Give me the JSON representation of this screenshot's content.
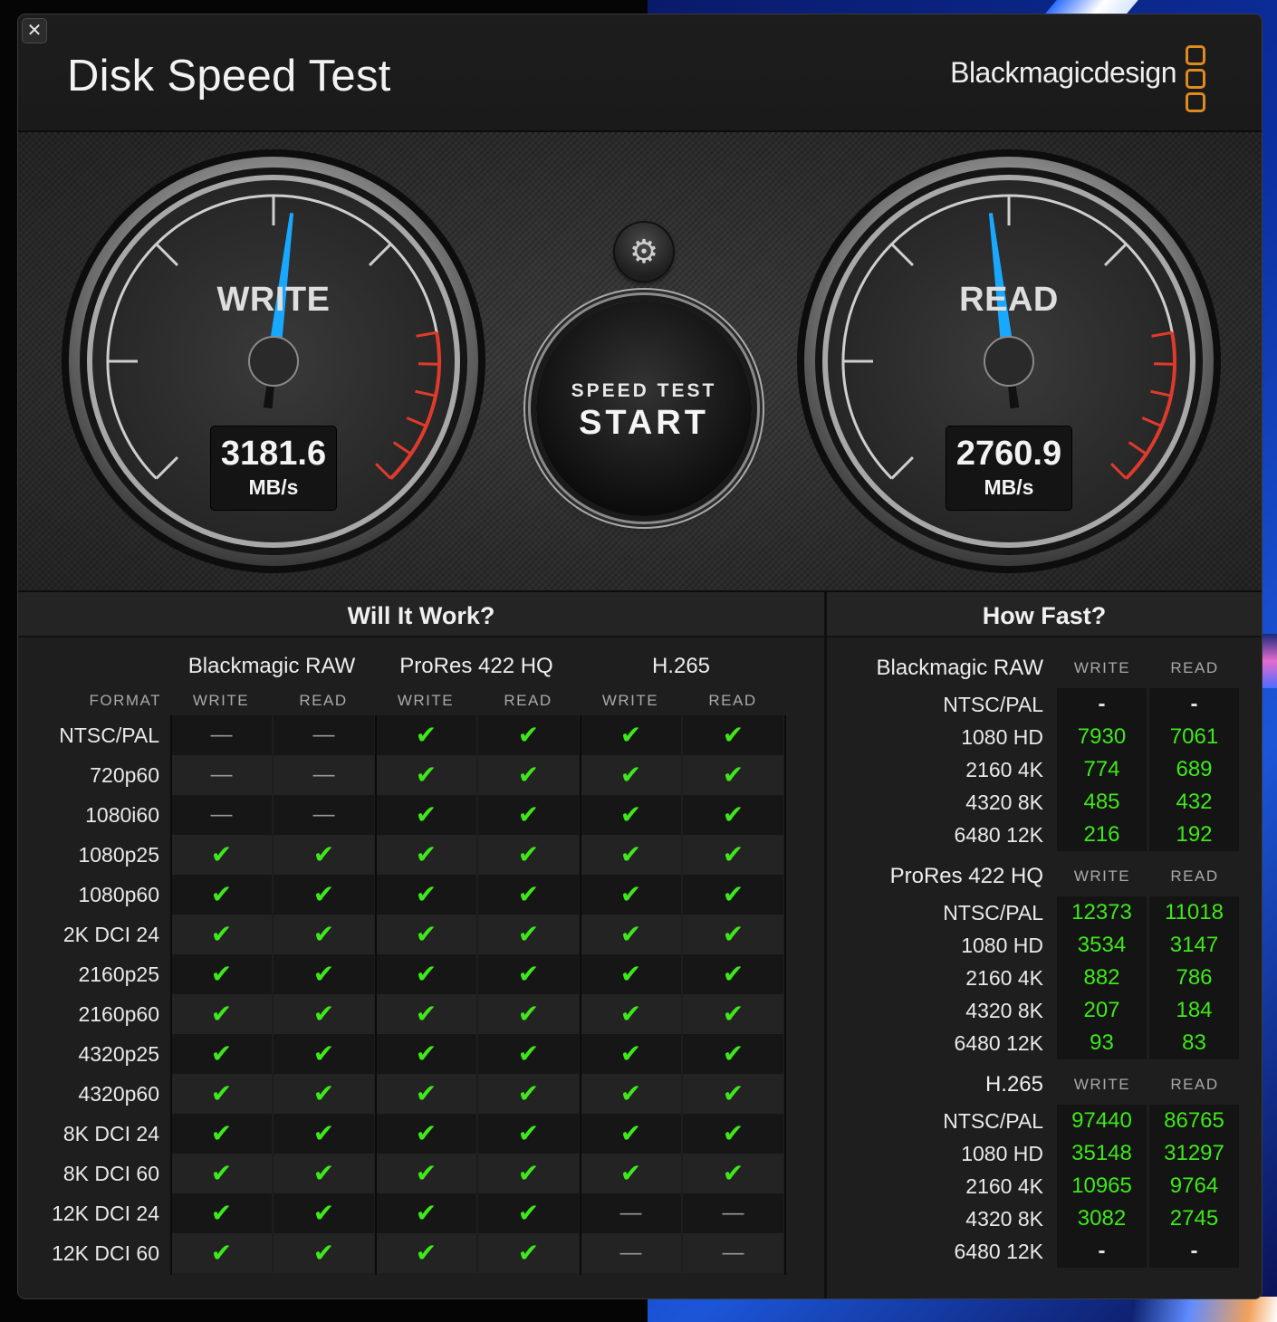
{
  "window": {
    "title": "Disk Speed Test",
    "brand": "Blackmagicdesign",
    "close_glyph": "✕",
    "accent_color": "#e08a1e",
    "check_color": "#3ee81a"
  },
  "gauges": {
    "write": {
      "label": "WRITE",
      "value": "3181.6",
      "unit": "MB/s",
      "needle_color": "#18a8ff"
    },
    "read": {
      "label": "READ",
      "value": "2760.9",
      "unit": "MB/s",
      "needle_color": "#18a8ff"
    }
  },
  "controls": {
    "settings_icon": "gear-icon",
    "settings_glyph": "⚙",
    "start_line1": "SPEED TEST",
    "start_line2": "START"
  },
  "will_it_work": {
    "title": "Will It Work?",
    "format_label": "FORMAT",
    "groups": [
      "Blackmagic RAW",
      "ProRes 422 HQ",
      "H.265"
    ],
    "sub_cols": [
      "WRITE",
      "READ"
    ],
    "rows": [
      {
        "format": "NTSC/PAL",
        "cells": [
          "-",
          "-",
          "ok",
          "ok",
          "ok",
          "ok"
        ]
      },
      {
        "format": "720p60",
        "cells": [
          "-",
          "-",
          "ok",
          "ok",
          "ok",
          "ok"
        ]
      },
      {
        "format": "1080i60",
        "cells": [
          "-",
          "-",
          "ok",
          "ok",
          "ok",
          "ok"
        ]
      },
      {
        "format": "1080p25",
        "cells": [
          "ok",
          "ok",
          "ok",
          "ok",
          "ok",
          "ok"
        ]
      },
      {
        "format": "1080p60",
        "cells": [
          "ok",
          "ok",
          "ok",
          "ok",
          "ok",
          "ok"
        ]
      },
      {
        "format": "2K DCI 24",
        "cells": [
          "ok",
          "ok",
          "ok",
          "ok",
          "ok",
          "ok"
        ]
      },
      {
        "format": "2160p25",
        "cells": [
          "ok",
          "ok",
          "ok",
          "ok",
          "ok",
          "ok"
        ]
      },
      {
        "format": "2160p60",
        "cells": [
          "ok",
          "ok",
          "ok",
          "ok",
          "ok",
          "ok"
        ]
      },
      {
        "format": "4320p25",
        "cells": [
          "ok",
          "ok",
          "ok",
          "ok",
          "ok",
          "ok"
        ]
      },
      {
        "format": "4320p60",
        "cells": [
          "ok",
          "ok",
          "ok",
          "ok",
          "ok",
          "ok"
        ]
      },
      {
        "format": "8K DCI 24",
        "cells": [
          "ok",
          "ok",
          "ok",
          "ok",
          "ok",
          "ok"
        ]
      },
      {
        "format": "8K DCI 60",
        "cells": [
          "ok",
          "ok",
          "ok",
          "ok",
          "ok",
          "ok"
        ]
      },
      {
        "format": "12K DCI 24",
        "cells": [
          "ok",
          "ok",
          "ok",
          "ok",
          "-",
          "-"
        ]
      },
      {
        "format": "12K DCI 60",
        "cells": [
          "ok",
          "ok",
          "ok",
          "ok",
          "-",
          "-"
        ]
      }
    ]
  },
  "how_fast": {
    "title": "How Fast?",
    "write_label": "WRITE",
    "read_label": "READ",
    "sections": [
      {
        "codec": "Blackmagic RAW",
        "rows": [
          {
            "format": "NTSC/PAL",
            "write": "-",
            "read": "-"
          },
          {
            "format": "1080 HD",
            "write": "7930",
            "read": "7061"
          },
          {
            "format": "2160 4K",
            "write": "774",
            "read": "689"
          },
          {
            "format": "4320 8K",
            "write": "485",
            "read": "432"
          },
          {
            "format": "6480 12K",
            "write": "216",
            "read": "192"
          }
        ]
      },
      {
        "codec": "ProRes 422 HQ",
        "rows": [
          {
            "format": "NTSC/PAL",
            "write": "12373",
            "read": "11018"
          },
          {
            "format": "1080 HD",
            "write": "3534",
            "read": "3147"
          },
          {
            "format": "2160 4K",
            "write": "882",
            "read": "786"
          },
          {
            "format": "4320 8K",
            "write": "207",
            "read": "184"
          },
          {
            "format": "6480 12K",
            "write": "93",
            "read": "83"
          }
        ]
      },
      {
        "codec": "H.265",
        "rows": [
          {
            "format": "NTSC/PAL",
            "write": "97440",
            "read": "86765"
          },
          {
            "format": "1080 HD",
            "write": "35148",
            "read": "31297"
          },
          {
            "format": "2160 4K",
            "write": "10965",
            "read": "9764"
          },
          {
            "format": "4320 8K",
            "write": "3082",
            "read": "2745"
          },
          {
            "format": "6480 12K",
            "write": "-",
            "read": "-"
          }
        ]
      }
    ]
  }
}
